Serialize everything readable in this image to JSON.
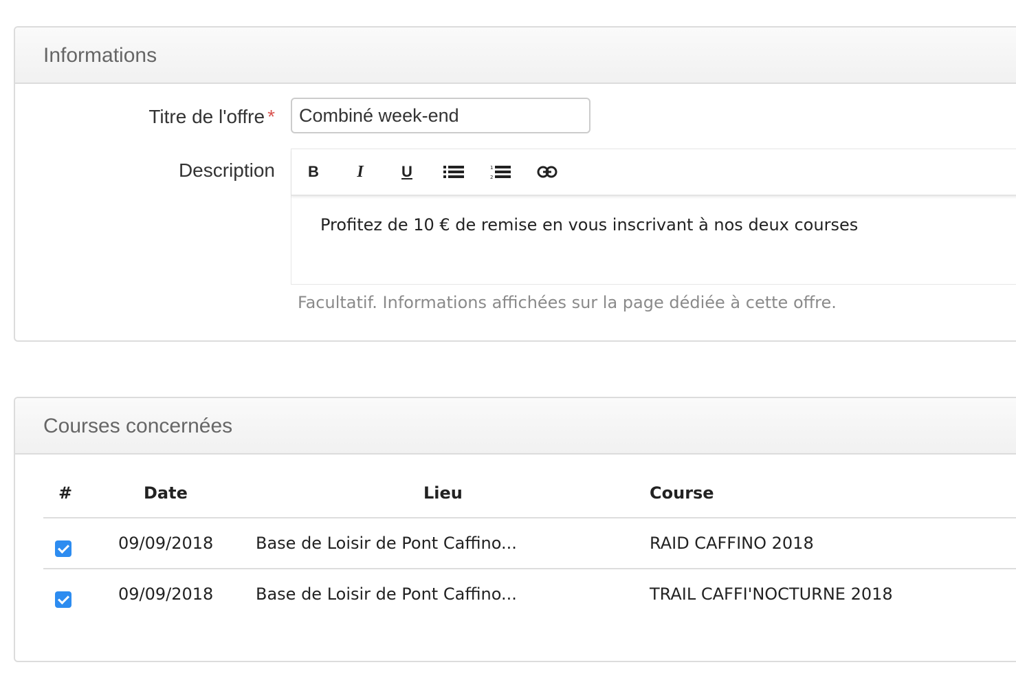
{
  "info_panel": {
    "title": "Informations",
    "title_label": "Titre de l'offre",
    "required_mark": "*",
    "title_value": "Combiné week-end",
    "description_label": "Description",
    "toolbar": {
      "bold": "B",
      "italic": "I",
      "underline": "U",
      "bullet_list_icon": "list-ul-icon",
      "ordered_list_icon": "list-ol-icon",
      "link_icon": "link-icon"
    },
    "description_text": "Profitez de 10 € de remise en vous inscrivant à nos deux courses",
    "help_text": "Facultatif. Informations affichées sur la page dédiée à cette offre."
  },
  "courses_panel": {
    "title": "Courses concernées",
    "columns": [
      "#",
      "Date",
      "Lieu",
      "Course"
    ],
    "rows": [
      {
        "checked": true,
        "date": "09/09/2018",
        "lieu": "Base de Loisir de Pont Caffino...",
        "course": "RAID CAFFINO 2018"
      },
      {
        "checked": true,
        "date": "09/09/2018",
        "lieu": "Base de Loisir de Pont Caffino...",
        "course": "TRAIL CAFFI'NOCTURNE 2018"
      }
    ]
  },
  "colors": {
    "accent": "#2d8cf0",
    "required": "#d9534f",
    "help": "#8a8a8a"
  }
}
